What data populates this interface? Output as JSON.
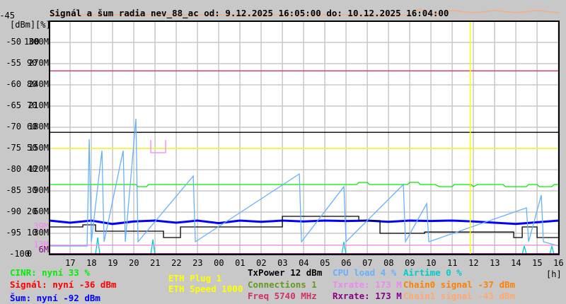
{
  "title": "Signál a šum radia nev_88_ac od: 9.12.2025 16:05:00 do: 10.12.2025 16:04:00",
  "legend": {
    "cinr": {
      "text": "CINR: nyní 33 %",
      "color": "#00ee00"
    },
    "signal": {
      "text": "Signál: nyní -36 dBm",
      "color": "#ff0000"
    },
    "noise": {
      "text": "Šum: nyní -92 dBm",
      "color": "#0000ff"
    },
    "eth_plug": {
      "text": "ETH Plug 1",
      "color": "#ffff00"
    },
    "eth_speed": {
      "text": "ETH Speed 1000",
      "color": "#ffff00"
    },
    "txpower": {
      "text": "TxPower 12 dBm",
      "color": "#000000"
    },
    "connections": {
      "text": "Connections 1",
      "color": "#669922"
    },
    "freq": {
      "text": "Freq 5740 MHz",
      "color": "#cc3366"
    },
    "cpu": {
      "text": "CPU load 4 %",
      "color": "#66b0ff"
    },
    "txrate": {
      "text": "Txrate: 173 M",
      "color": "#ee88ee"
    },
    "rxrate": {
      "text": "Rxrate: 173 M",
      "color": "#880088"
    },
    "airtime": {
      "text": "Airtime 0 %",
      "color": "#00cccc"
    },
    "chain0": {
      "text": "Chain0 signal -37 dBm",
      "color": "#ff8000"
    },
    "chain1": {
      "text": "Chain1 signal -43 dBm",
      "color": "#ffa870"
    }
  },
  "chart_data": {
    "type": "line",
    "title": "Signál a šum radia nev_88_ac od: 9.12.2025 16:05:00 do: 10.12.2025 16:04:00",
    "xlabel": "[h]",
    "x_ticks": [
      "17",
      "18",
      "19",
      "20",
      "21",
      "22",
      "23",
      "00",
      "01",
      "02",
      "03",
      "04",
      "05",
      "06",
      "07",
      "08",
      "09",
      "10",
      "11",
      "12",
      "13",
      "14",
      "15",
      "16"
    ],
    "xlim_hours_from_17": [
      -0.97,
      23.03
    ],
    "ylabel_units": [
      "[dBm]",
      "[%]"
    ],
    "ylim": [
      -100,
      -45
    ],
    "y_ticks": [
      {
        "dbm": "-45",
        "pct": "",
        "rate": ""
      },
      {
        "dbm": "-50",
        "pct": "100",
        "rate": "300M"
      },
      {
        "dbm": "-55",
        "pct": "90",
        "rate": "270M"
      },
      {
        "dbm": "-60",
        "pct": "80",
        "rate": "240M"
      },
      {
        "dbm": "-65",
        "pct": "70",
        "rate": "210M"
      },
      {
        "dbm": "-70",
        "pct": "60",
        "rate": "180M"
      },
      {
        "dbm": "-75",
        "pct": "50",
        "rate": "150M"
      },
      {
        "dbm": "-80",
        "pct": "40",
        "rate": "120M"
      },
      {
        "dbm": "-85",
        "pct": "30",
        "rate": "90M"
      },
      {
        "dbm": "-90",
        "pct": "20",
        "rate": "60M"
      },
      {
        "dbm": "-95",
        "pct": "10",
        "rate": "30M"
      },
      {
        "dbm": "-100",
        "pct": "0",
        "rate": ""
      }
    ],
    "extra_rate_labels": [
      {
        "text": "39M",
        "dbm": -93.5,
        "color": "#ee88ee"
      },
      {
        "text": "13M",
        "dbm": -97.8,
        "color": "#ee88ee"
      },
      {
        "text": "6M",
        "dbm": -99,
        "color": "#880088"
      }
    ],
    "marker_hour": 18.85,
    "marker_color": "#ffff00",
    "series": [
      {
        "name": "Freq",
        "color": "#cc3366",
        "points": [
          [
            -0.97,
            -56.7
          ],
          [
            23.03,
            -56.7
          ]
        ]
      },
      {
        "name": "TxPower",
        "color": "#000000",
        "points": [
          [
            -0.97,
            -71.2
          ],
          [
            23.03,
            -71.2
          ]
        ]
      },
      {
        "name": "ETH Speed",
        "color": "#ffff00",
        "points": [
          [
            -0.97,
            -75
          ],
          [
            23.03,
            -75
          ]
        ]
      },
      {
        "name": "CINR",
        "color": "#00ee00",
        "points": [
          [
            -0.97,
            -83.5
          ],
          [
            3.1,
            -83.5
          ],
          [
            3.2,
            -84
          ],
          [
            3.6,
            -84
          ],
          [
            3.7,
            -83.5
          ],
          [
            13.5,
            -83.5
          ],
          [
            13.6,
            -83
          ],
          [
            14.0,
            -83
          ],
          [
            14.1,
            -83.5
          ],
          [
            15.9,
            -83.5
          ],
          [
            16.0,
            -83
          ],
          [
            16.4,
            -83
          ],
          [
            16.5,
            -83.5
          ],
          [
            17.2,
            -83.5
          ],
          [
            17.4,
            -84
          ],
          [
            18.0,
            -84
          ],
          [
            18.1,
            -83.5
          ],
          [
            18.9,
            -83.5
          ],
          [
            19.0,
            -84
          ],
          [
            19.2,
            -83.5
          ],
          [
            20.4,
            -83.5
          ],
          [
            20.5,
            -84
          ],
          [
            21.5,
            -84
          ],
          [
            21.6,
            -83.5
          ],
          [
            22.0,
            -83.5
          ],
          [
            22.1,
            -84
          ],
          [
            22.7,
            -84
          ],
          [
            22.8,
            -83.5
          ],
          [
            23.03,
            -83.5
          ]
        ]
      },
      {
        "name": "Šum",
        "color": "#0000ff",
        "points": [
          [
            -0.97,
            -92
          ],
          [
            0,
            -92.5
          ],
          [
            1,
            -92
          ],
          [
            2,
            -92.8
          ],
          [
            3,
            -92.2
          ],
          [
            4,
            -92
          ],
          [
            5,
            -92.5
          ],
          [
            6,
            -92
          ],
          [
            7,
            -92.6
          ],
          [
            8,
            -92
          ],
          [
            9,
            -92.3
          ],
          [
            10,
            -92
          ],
          [
            11,
            -92.2
          ],
          [
            12,
            -92
          ],
          [
            13,
            -92.1
          ],
          [
            14,
            -92
          ],
          [
            15,
            -92.3
          ],
          [
            16,
            -92
          ],
          [
            17,
            -92.1
          ],
          [
            18,
            -92
          ],
          [
            19,
            -92.2
          ],
          [
            20,
            -92.5
          ],
          [
            21,
            -92.8
          ],
          [
            22,
            -92.4
          ],
          [
            23.03,
            -92
          ]
        ]
      },
      {
        "name": "Connections",
        "color": "#000000",
        "points": [
          [
            -0.97,
            -93.5
          ],
          [
            0.6,
            -93.5
          ],
          [
            0.6,
            -93
          ],
          [
            1.2,
            -93
          ],
          [
            1.2,
            -94.5
          ],
          [
            4.4,
            -94.5
          ],
          [
            4.4,
            -96
          ],
          [
            5.2,
            -96
          ],
          [
            5.2,
            -93.5
          ],
          [
            10.0,
            -93.5
          ],
          [
            10.0,
            -91
          ],
          [
            13.6,
            -91
          ],
          [
            13.6,
            -92
          ],
          [
            14.6,
            -92
          ],
          [
            14.6,
            -95
          ],
          [
            16.7,
            -95
          ],
          [
            16.7,
            -94.7
          ],
          [
            18.9,
            -94.7
          ],
          [
            18.9,
            -94.7
          ],
          [
            20.9,
            -94.7
          ],
          [
            20.9,
            -96
          ],
          [
            21.3,
            -96
          ],
          [
            21.3,
            -93.5
          ],
          [
            22.0,
            -93.5
          ],
          [
            22.0,
            -96
          ],
          [
            23.03,
            -96
          ]
        ]
      },
      {
        "name": "CPU load",
        "color": "#66b0ff",
        "points": [
          [
            -0.97,
            -98
          ],
          [
            0.8,
            -98
          ],
          [
            0.9,
            -72.8
          ],
          [
            1.0,
            -97
          ],
          [
            1.5,
            -75.5
          ],
          [
            1.6,
            -97
          ],
          [
            2.5,
            -75.5
          ],
          [
            2.6,
            -97
          ],
          [
            3.1,
            -68
          ],
          [
            3.2,
            -97
          ],
          [
            5.8,
            -81.5
          ],
          [
            5.9,
            -97
          ],
          [
            10.8,
            -81
          ],
          [
            10.9,
            -97
          ],
          [
            12.9,
            -84
          ],
          [
            13.0,
            -97
          ],
          [
            15.7,
            -83.5
          ],
          [
            15.8,
            -97
          ],
          [
            16.8,
            -88
          ],
          [
            16.9,
            -97
          ],
          [
            21.5,
            -89
          ],
          [
            21.6,
            -97
          ],
          [
            22.2,
            -86
          ],
          [
            22.3,
            -97
          ],
          [
            23.03,
            -98
          ]
        ]
      },
      {
        "name": "Airtime",
        "color": "#00cccc",
        "points": [
          [
            -0.97,
            -100
          ],
          [
            1.2,
            -100
          ],
          [
            1.3,
            -96
          ],
          [
            1.4,
            -100
          ],
          [
            3.8,
            -100
          ],
          [
            3.9,
            -96.5
          ],
          [
            4.0,
            -100
          ],
          [
            12.8,
            -100
          ],
          [
            12.9,
            -97
          ],
          [
            13.0,
            -100
          ],
          [
            21.3,
            -100
          ],
          [
            21.4,
            -98
          ],
          [
            21.5,
            -100
          ],
          [
            22.6,
            -100
          ],
          [
            22.7,
            -98
          ],
          [
            22.8,
            -100
          ],
          [
            23.03,
            -100
          ]
        ]
      },
      {
        "name": "Txrate",
        "color": "#ee88ee",
        "points": [
          [
            -0.97,
            -97.8
          ],
          [
            23.03,
            -97.8
          ]
        ]
      },
      {
        "name": "Rxrate",
        "color": "#880088",
        "points": [
          [
            -0.97,
            -99.8
          ],
          [
            23.03,
            -99.8
          ]
        ]
      },
      {
        "name": "Chain1 signal",
        "color": "#ffa870",
        "points": [
          [
            -0.97,
            -43.5
          ],
          [
            16,
            -43.5
          ],
          [
            16.5,
            -42
          ],
          [
            17,
            -43.5
          ],
          [
            18,
            -42.5
          ],
          [
            19,
            -43
          ],
          [
            20,
            -42.5
          ],
          [
            21,
            -43
          ],
          [
            22,
            -42.5
          ],
          [
            23.03,
            -43
          ]
        ]
      },
      {
        "name": "Txrate spikes",
        "color": "#ee88ee",
        "points": [
          [
            3.8,
            -73
          ],
          [
            3.8,
            -76
          ],
          [
            4.5,
            -76
          ],
          [
            4.5,
            -73
          ]
        ]
      }
    ]
  }
}
